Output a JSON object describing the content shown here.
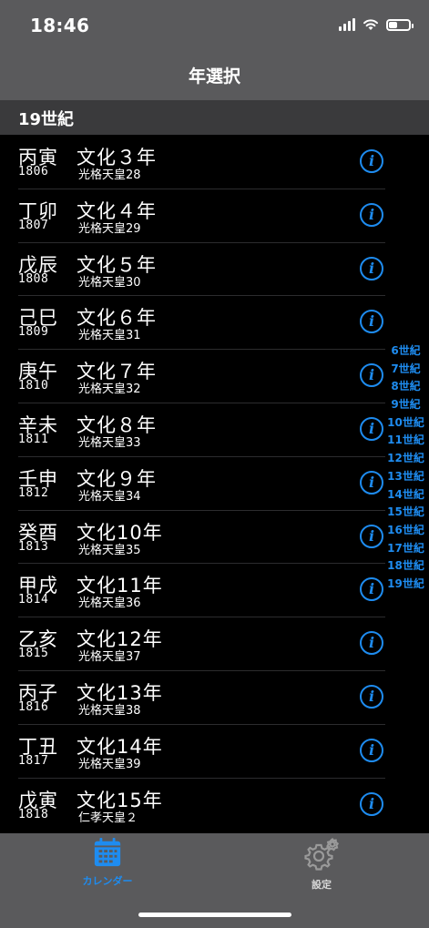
{
  "status_bar": {
    "time": "18:46"
  },
  "nav": {
    "title": "年選択"
  },
  "section": {
    "title": "19世紀"
  },
  "rows": [
    {
      "kanshi": "丙寅",
      "ad": "1806",
      "era": "文化３年",
      "emperor": "光格天皇28"
    },
    {
      "kanshi": "丁卯",
      "ad": "1807",
      "era": "文化４年",
      "emperor": "光格天皇29"
    },
    {
      "kanshi": "戊辰",
      "ad": "1808",
      "era": "文化５年",
      "emperor": "光格天皇30"
    },
    {
      "kanshi": "己巳",
      "ad": "1809",
      "era": "文化６年",
      "emperor": "光格天皇31"
    },
    {
      "kanshi": "庚午",
      "ad": "1810",
      "era": "文化７年",
      "emperor": "光格天皇32"
    },
    {
      "kanshi": "辛未",
      "ad": "1811",
      "era": "文化８年",
      "emperor": "光格天皇33"
    },
    {
      "kanshi": "壬申",
      "ad": "1812",
      "era": "文化９年",
      "emperor": "光格天皇34"
    },
    {
      "kanshi": "癸酉",
      "ad": "1813",
      "era": "文化10年",
      "emperor": "光格天皇35"
    },
    {
      "kanshi": "甲戌",
      "ad": "1814",
      "era": "文化11年",
      "emperor": "光格天皇36"
    },
    {
      "kanshi": "乙亥",
      "ad": "1815",
      "era": "文化12年",
      "emperor": "光格天皇37"
    },
    {
      "kanshi": "丙子",
      "ad": "1816",
      "era": "文化13年",
      "emperor": "光格天皇38"
    },
    {
      "kanshi": "丁丑",
      "ad": "1817",
      "era": "文化14年",
      "emperor": "光格天皇39"
    },
    {
      "kanshi": "戊寅",
      "ad": "1818",
      "era": "文化15年",
      "emperor": "仁孝天皇２"
    }
  ],
  "info_icon": "info-circle-icon",
  "section_index": [
    "6世紀",
    "7世紀",
    "8世紀",
    "9世紀",
    "10世紀",
    "11世紀",
    "12世紀",
    "13世紀",
    "14世紀",
    "15世紀",
    "16世紀",
    "17世紀",
    "18世紀",
    "19世紀"
  ],
  "tabs": [
    {
      "label": "カレンダー",
      "icon": "calendar-icon",
      "selected": true
    },
    {
      "label": "設定",
      "icon": "gear-icon",
      "selected": false
    }
  ],
  "colors": {
    "accent": "#1e8cf0",
    "bar_background": "#5a5a5c",
    "section_background": "#3a3a3c",
    "list_background": "#000000"
  }
}
